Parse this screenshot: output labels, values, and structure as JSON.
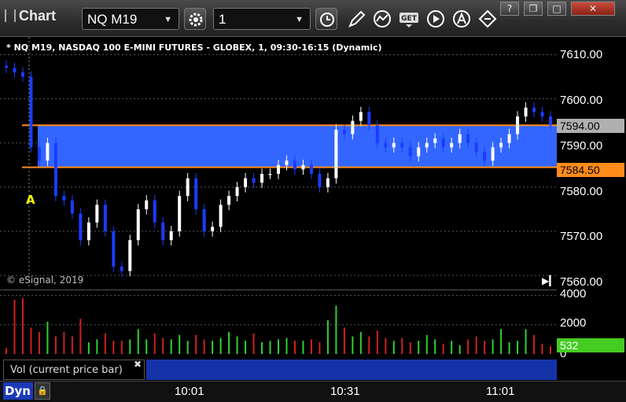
{
  "window": {
    "title": "Chart",
    "symbol": "NQ M19",
    "interval": "1",
    "buttons": [
      "help",
      "restore",
      "maximize",
      "close"
    ],
    "help_glyph": "?",
    "restore_glyph": "❐",
    "maximize_glyph": "□",
    "close_glyph": "✕"
  },
  "toolbar_icons": [
    "gear-icon",
    "clock-icon",
    "pencil-icon",
    "study-icon",
    "get-icon",
    "play-icon",
    "alert-icon",
    "link-icon"
  ],
  "chart_header": "* NQ M19, NASDAQ 100 E-MINI FUTURES - GLOBEX, 1, 09:30-16:15 (Dynamic)",
  "copyright": "© eSignal, 2019",
  "marker": "A",
  "colors": {
    "up": "#ffffff",
    "down": "#1a3cff",
    "band": "#3366ff",
    "band_line": "#ff8c1a",
    "vol_up": "#2fd02f",
    "vol_down": "#d02020",
    "current_badge": "#b0b0b0",
    "level_badge": "#ff8c1a",
    "vol_badge": "#44cc22"
  },
  "price_axis": {
    "labels": [
      "7610.00",
      "7600.00",
      "7590.00",
      "7580.00",
      "7570.00",
      "7560.00"
    ],
    "current_price": "7594.00",
    "level_price": "7584.50"
  },
  "volume_axis": {
    "labels": [
      "4000",
      "2000",
      "0"
    ],
    "current_volume": "532"
  },
  "volume_panel_label": "Vol (current price bar)",
  "close_glyph": "✖",
  "time_labels": [
    "10:01",
    "10:31",
    "11:01"
  ],
  "dyn_label": "Dyn",
  "dyn_icon_glyph": "🔒",
  "chart_data": {
    "type": "candlestick",
    "title": "* NQ M19, NASDAQ 100 E-MINI FUTURES - GLOBEX, 1, 09:30-16:15 (Dynamic)",
    "ylim": [
      7557,
      7614
    ],
    "band": {
      "high": 7594.0,
      "low": 7584.5
    },
    "x": [
      "10:01",
      "10:31",
      "11:01"
    ],
    "closes": [
      7607,
      7606,
      7605,
      7589,
      7586,
      7590,
      7578,
      7577,
      7574,
      7568,
      7572,
      7576,
      7570,
      7562,
      7561,
      7568,
      7575,
      7577,
      7572,
      7568,
      7570,
      7578,
      7582,
      7575,
      7570,
      7571,
      7576,
      7578,
      7580,
      7582,
      7581,
      7583,
      7583,
      7585,
      7586,
      7584,
      7585,
      7583,
      7580,
      7582,
      7593,
      7592,
      7595,
      7597,
      7594,
      7590,
      7589,
      7590,
      7589,
      7587,
      7589,
      7590,
      7591,
      7589,
      7590,
      7592,
      7590,
      7588,
      7586,
      7589,
      7590,
      7592,
      7596,
      7598,
      7597,
      7596,
      7594
    ],
    "volumes": [
      400,
      3700,
      3800,
      1800,
      1500,
      2200,
      1200,
      1500,
      1200,
      2400,
      800,
      1000,
      1400,
      900,
      900,
      1000,
      1700,
      1000,
      1400,
      1100,
      1000,
      1300,
      900,
      1300,
      1000,
      900,
      1100,
      1500,
      1200,
      900,
      1400,
      800,
      900,
      1000,
      1100,
      900,
      900,
      1000,
      800,
      2300,
      3300,
      1800,
      1200,
      1500,
      1200,
      1600,
      1100,
      900,
      1100,
      800,
      900,
      1300,
      1000,
      700,
      900,
      600,
      1000,
      1200,
      900,
      1000,
      1700,
      800,
      900,
      1700,
      1300,
      700,
      532
    ]
  }
}
